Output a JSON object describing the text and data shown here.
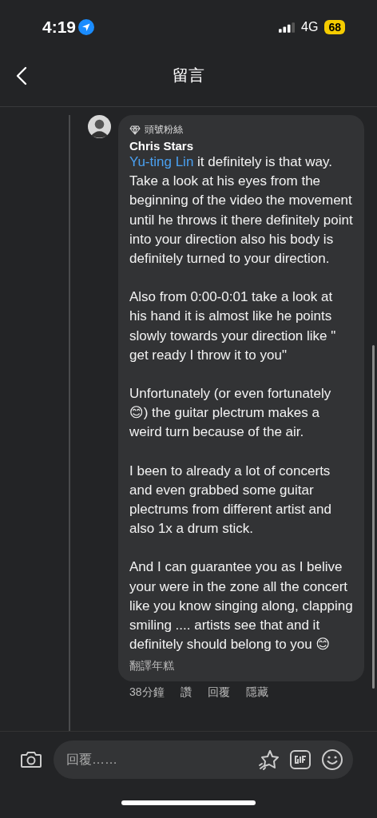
{
  "status_bar": {
    "time": "4:19",
    "network": "4G",
    "battery": "68"
  },
  "nav": {
    "title": "留言"
  },
  "comment": {
    "badge": "頭號粉絲",
    "author": "Chris Stars",
    "mention": "Yu-ting Lin",
    "paragraphs": [
      "it definitely is that way. Take a look at his eyes from the beginning of the video the movement until he throws it there definitely point into your direction also his body is definitely turned to your direction.",
      "Also from 0:00-0:01 take a look at his hand it is almost like he points slowly towards your direction like \" get ready I throw it to you\"",
      "Unfortunately (or even fortunately 😊) the guitar plectrum makes a weird turn because of the air.",
      "I been to already a lot of concerts and even grabbed some guitar plectrums from different artist and also 1x a drum stick.",
      "And I can guarantee you as I belive your were in the zone all the concert like you know singing along, clapping smiling .... artists see that and it definitely should belong to you 😊"
    ],
    "translate": "翻譯年糕",
    "time": "38分鐘",
    "actions": [
      "讚",
      "回覆",
      "隱藏"
    ]
  },
  "composer": {
    "placeholder": "回覆……"
  }
}
